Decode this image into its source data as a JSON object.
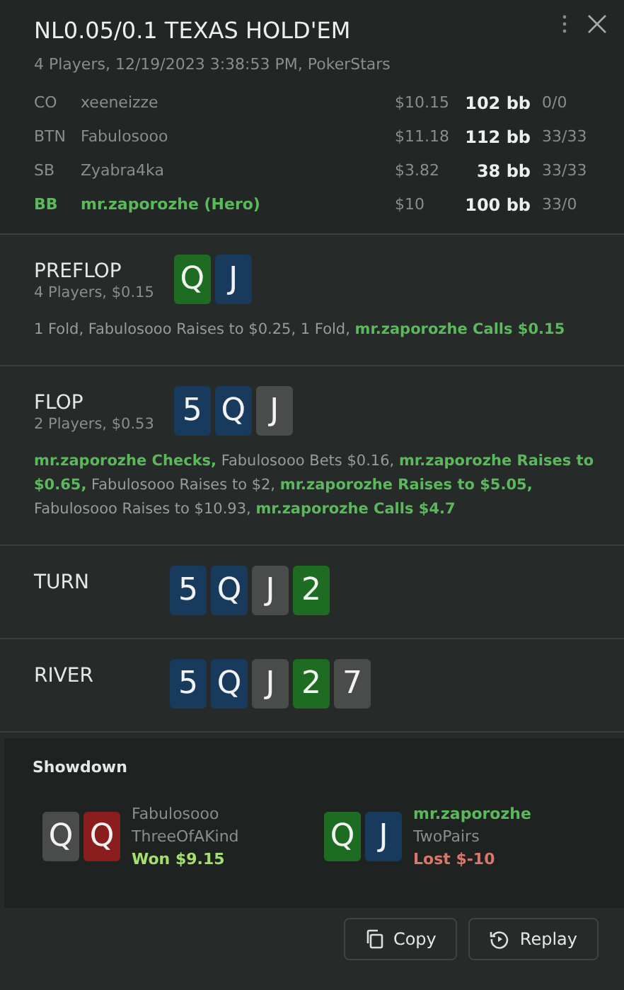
{
  "header": {
    "title": "NL0.05/0.1 TEXAS HOLD'EM",
    "subtitle": "4 Players, 12/19/2023 3:38:53 PM, PokerStars"
  },
  "players": [
    {
      "position": "CO",
      "name": "xeeneizze",
      "stack": "$10.15",
      "bb": "102 bb",
      "stats": "0/0",
      "hero": false
    },
    {
      "position": "BTN",
      "name": "Fabulosooo",
      "stack": "$11.18",
      "bb": "112 bb",
      "stats": "33/33",
      "hero": false
    },
    {
      "position": "SB",
      "name": "Zyabra4ka",
      "stack": "$3.82",
      "bb": "38 bb",
      "stats": "33/33",
      "hero": false
    },
    {
      "position": "BB",
      "name": "mr.zaporozhe (Hero)",
      "stack": "$10",
      "bb": "100 bb",
      "stats": "33/0",
      "hero": true
    }
  ],
  "streets": [
    {
      "name": "PREFLOP",
      "info": "4 Players, $0.15",
      "cards": [
        {
          "rank": "Q",
          "color": "#1e6b22"
        },
        {
          "rank": "J",
          "color": "#183a5c"
        }
      ],
      "actions": "1 Fold, Fabulosooo Raises to $0.25, 1 Fold, **mr.zaporozhe Calls $0.15**"
    },
    {
      "name": "FLOP",
      "info": "2 Players, $0.53",
      "cards": [
        {
          "rank": "5",
          "color": "#183a5c"
        },
        {
          "rank": "Q",
          "color": "#183a5c"
        },
        {
          "rank": "J",
          "color": "#4a4c4c"
        }
      ],
      "actions": "**mr.zaporozhe Checks,** Fabulosooo Bets $0.16, **mr.zaporozhe Raises to $0.65,** Fabulosooo Raises to $2, **mr.zaporozhe Raises to $5.05,** Fabulosooo Raises to $10.93, **mr.zaporozhe Calls $4.7**"
    },
    {
      "name": "TURN",
      "cards": [
        {
          "rank": "5",
          "color": "#183a5c"
        },
        {
          "rank": "Q",
          "color": "#183a5c"
        },
        {
          "rank": "J",
          "color": "#4a4c4c"
        },
        {
          "rank": "2",
          "color": "#1e6b22"
        }
      ]
    },
    {
      "name": "RIVER",
      "cards": [
        {
          "rank": "5",
          "color": "#183a5c"
        },
        {
          "rank": "Q",
          "color": "#183a5c"
        },
        {
          "rank": "J",
          "color": "#4a4c4c"
        },
        {
          "rank": "2",
          "color": "#1e6b22"
        },
        {
          "rank": "7",
          "color": "#4a4c4c"
        }
      ]
    }
  ],
  "showdown": {
    "title": "Showdown",
    "hands": [
      {
        "player": "Fabulosooo",
        "hero": false,
        "cards": [
          {
            "rank": "Q",
            "color": "#4a4c4c"
          },
          {
            "rank": "Q",
            "color": "#8a1e1e"
          }
        ],
        "hand": "ThreeOfAKind",
        "result": "Won $9.15",
        "won": true
      },
      {
        "player": "mr.zaporozhe",
        "hero": true,
        "cards": [
          {
            "rank": "Q",
            "color": "#1e6b22"
          },
          {
            "rank": "J",
            "color": "#183a5c"
          }
        ],
        "hand": "TwoPairs",
        "result": "Lost $-10",
        "won": false
      }
    ]
  },
  "buttons": [
    {
      "kind": "copy",
      "label": "Copy"
    },
    {
      "kind": "replay",
      "label": "Replay"
    }
  ]
}
